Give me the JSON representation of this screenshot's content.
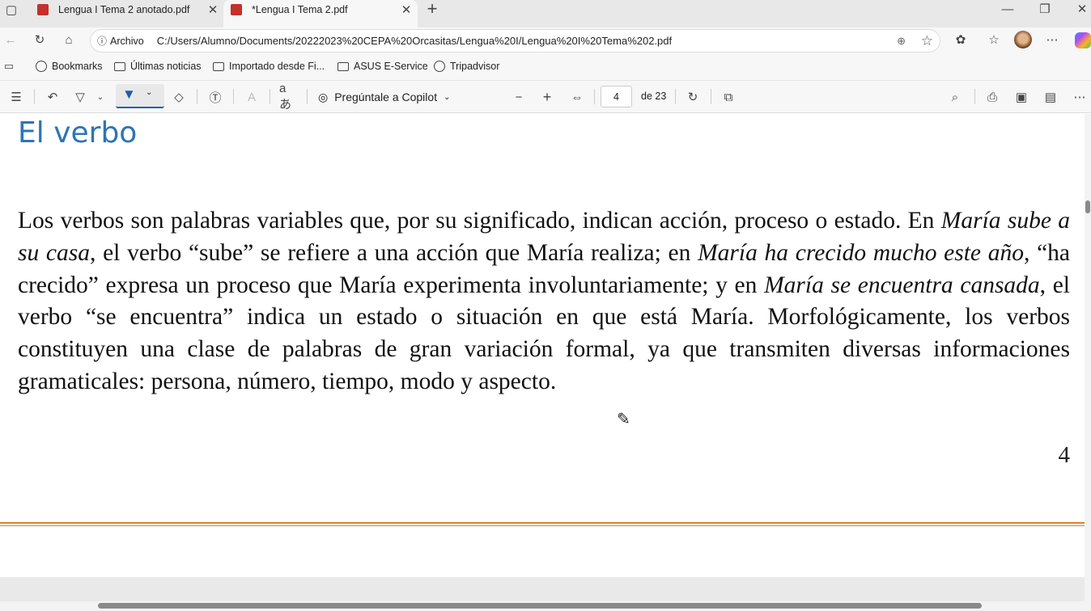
{
  "tabs": [
    {
      "label": "Lengua I Tema 2 anotado.pdf",
      "active": false
    },
    {
      "label": "*Lengua I Tema 2.pdf",
      "active": true
    }
  ],
  "address": {
    "scheme_label": "Archivo",
    "url": "C:/Users/Alumno/Documents/20222023%20CEPA%20Orcasitas/Lengua%20I/Lengua%20I%20Tema%202.pdf"
  },
  "bookmarks": [
    "Bookmarks",
    "Últimas noticias",
    "Importado desde Fi...",
    "ASUS E-Service",
    "Tripadvisor"
  ],
  "toolbar": {
    "copilot_label": "Pregúntale a Copilot",
    "page_current": "4",
    "page_total": "de 23"
  },
  "document": {
    "title": "El verbo",
    "paragraph": [
      {
        "t": "Los verbos son palabras variables que, por su significado, indican acción, proceso o estado. En ",
        "i": false
      },
      {
        "t": "María sube a su casa",
        "i": true
      },
      {
        "t": ", el verbo “sube” se refiere a una acción que María realiza; en ",
        "i": false
      },
      {
        "t": "María ha crecido mucho este año",
        "i": true
      },
      {
        "t": ", “ha crecido” expresa un proceso que María experimenta involuntariamente; y en ",
        "i": false
      },
      {
        "t": "María se encuentra cansada",
        "i": true
      },
      {
        "t": ", el verbo “se encuentra” indica un estado o situación en que está María. Morfológicamente, los verbos constituyen una clase de palabras de gran variación formal, ya que transmiten diversas informaciones gramaticales: persona, número, tiempo, modo y aspecto.",
        "i": false
      }
    ],
    "page_number": "4"
  },
  "colors": {
    "title": "#2e74b5",
    "rule": "#d9822b",
    "active_tool": "#1f5fa8"
  }
}
